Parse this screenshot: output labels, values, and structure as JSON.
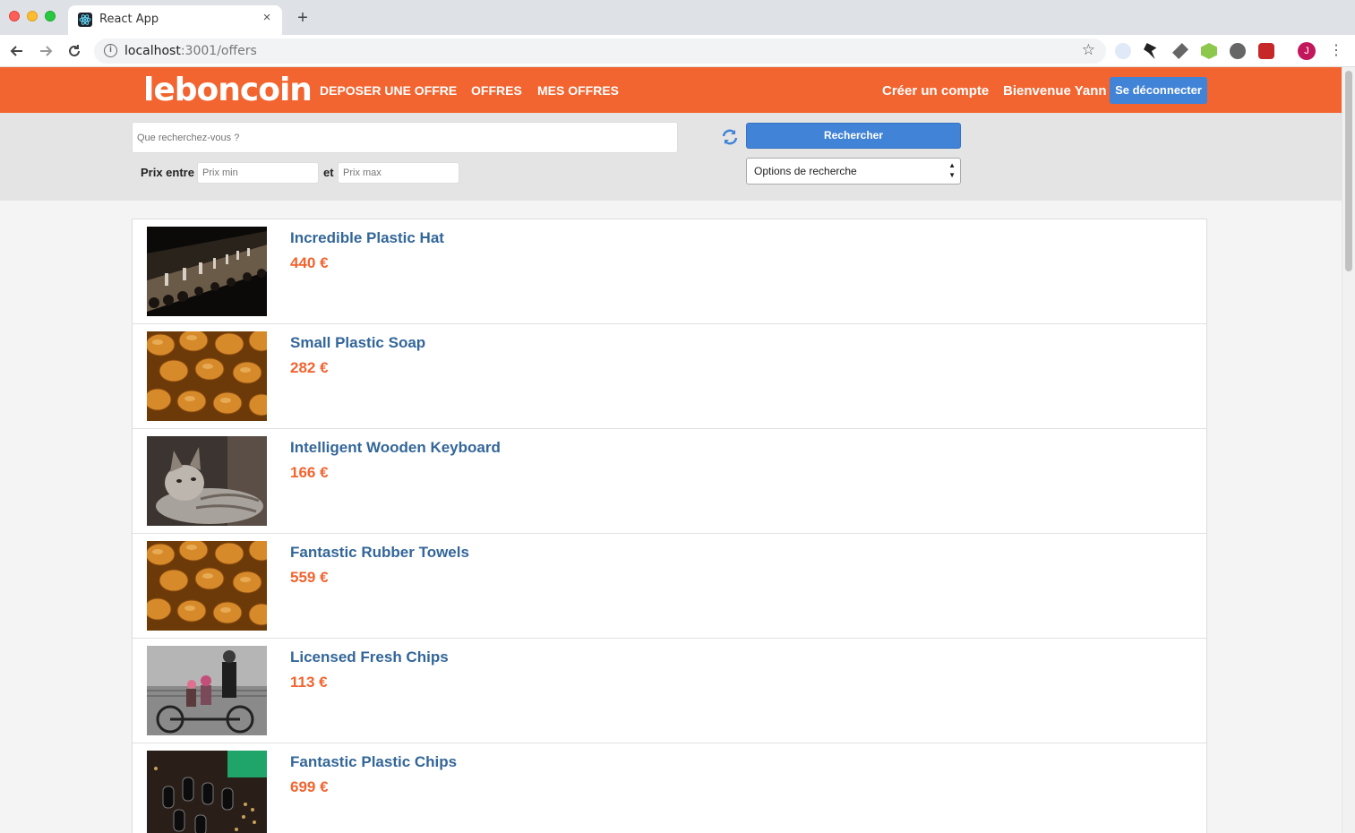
{
  "browser": {
    "tab_title": "React App",
    "tab_close": "×",
    "new_tab": "+",
    "url_host": "localhost",
    "url_rest": ":3001/offers",
    "avatar_letter": "J"
  },
  "header": {
    "logo": "leboncoin",
    "nav": [
      "DEPOSER UNE OFFRE",
      "OFFRES",
      "MES OFFRES"
    ],
    "create_account": "Créer un compte",
    "welcome": "Bienvenue Yann",
    "logout": "Se déconnecter"
  },
  "search": {
    "placeholder": "Que recherchez-vous ?",
    "button": "Rechercher",
    "price_label": "Prix entre",
    "price_min_placeholder": "Prix min",
    "and_label": "et",
    "price_max_placeholder": "Prix max",
    "options": "Options de recherche"
  },
  "offers": [
    {
      "title": "Incredible Plastic Hat",
      "price": "440 €",
      "image": "fashion-runway"
    },
    {
      "title": "Small Plastic Soap",
      "price": "282 €",
      "image": "nuts"
    },
    {
      "title": "Intelligent Wooden Keyboard",
      "price": "166 €",
      "image": "cat"
    },
    {
      "title": "Fantastic Rubber Towels",
      "price": "559 €",
      "image": "nuts"
    },
    {
      "title": "Licensed Fresh Chips",
      "price": "113 €",
      "image": "tandem-bike"
    },
    {
      "title": "Fantastic Plastic Chips",
      "price": "699 €",
      "image": "circuit-board"
    }
  ],
  "colors": {
    "brand": "#f26430",
    "button_blue": "#4183d7",
    "title_blue": "#336699"
  }
}
